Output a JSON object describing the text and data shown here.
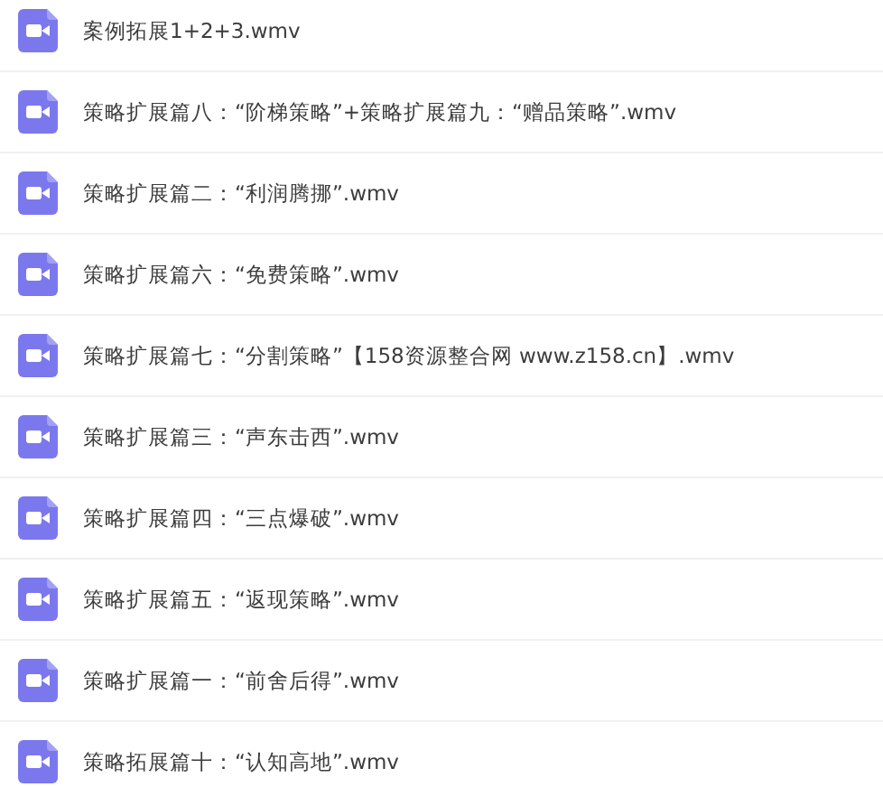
{
  "files": [
    {
      "name": "案例拓展1+2+3.wmv"
    },
    {
      "name": "策略扩展篇八：“阶梯策略”+策略扩展篇九：“赠品策略”.wmv"
    },
    {
      "name": "策略扩展篇二：“利润腾挪”.wmv"
    },
    {
      "name": "策略扩展篇六：“免费策略”.wmv"
    },
    {
      "name": "策略扩展篇七：“分割策略”【158资源整合网 www.z158.cn】.wmv"
    },
    {
      "name": "策略扩展篇三：“声东击西”.wmv"
    },
    {
      "name": "策略扩展篇四：“三点爆破”.wmv"
    },
    {
      "name": "策略扩展篇五：“返现策略”.wmv"
    },
    {
      "name": "策略扩展篇一：“前舍后得”.wmv"
    },
    {
      "name": "策略拓展篇十：“认知高地”.wmv"
    }
  ]
}
